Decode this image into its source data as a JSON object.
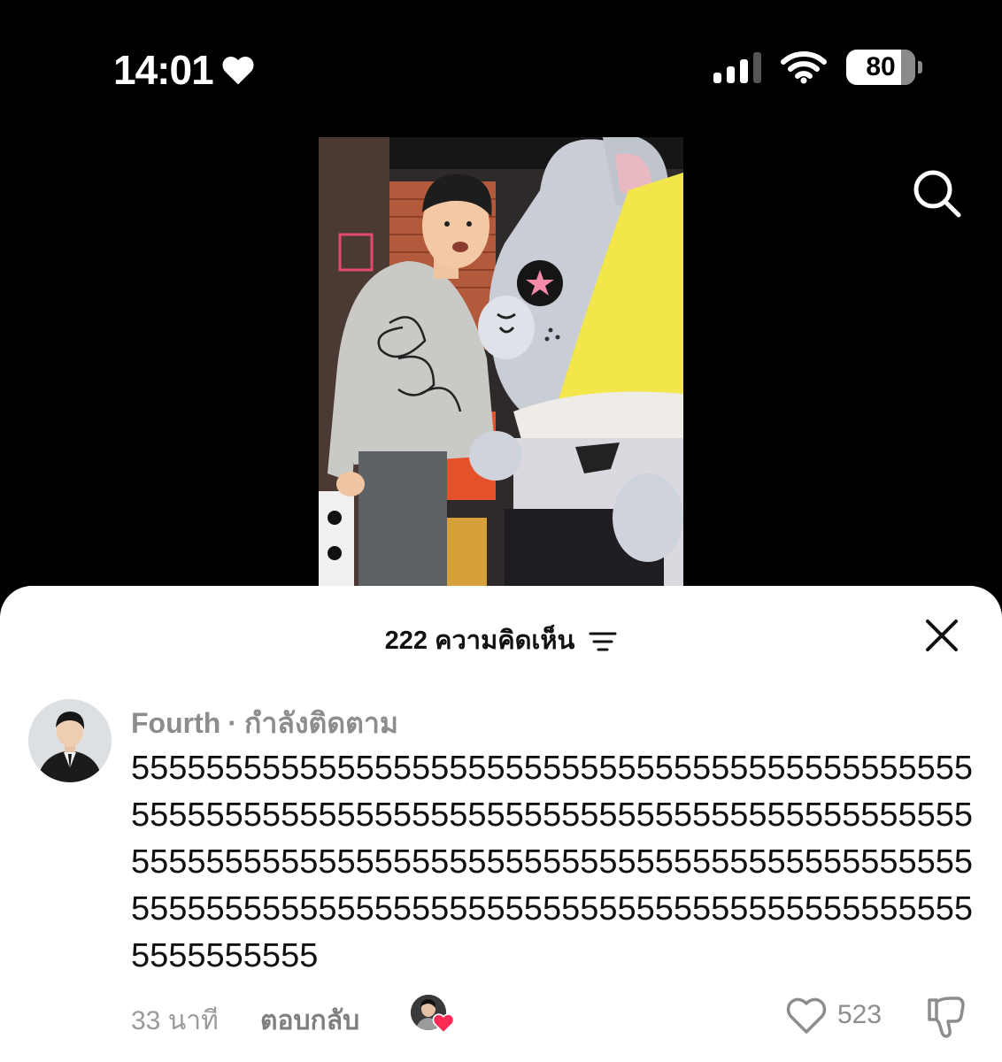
{
  "status_bar": {
    "time": "14:01",
    "battery": "80"
  },
  "comments_panel": {
    "count": "222",
    "title": "ความคิดเห็น"
  },
  "comment": {
    "username": "Fourth",
    "relation": "กำลังติดตาม",
    "text": "5555555555555555555555555555555555555555555555555555555555555555555555555555555555555555555555555555555555555555555555555555555555555555555555555555555555555555555555555555555555555555555555",
    "timestamp": "33 นาที",
    "reply_label": "ตอบกลับ",
    "likes": "523"
  },
  "colors": {
    "accent_heart": "#fe2c55",
    "meta_gray": "#8d8d8d"
  }
}
